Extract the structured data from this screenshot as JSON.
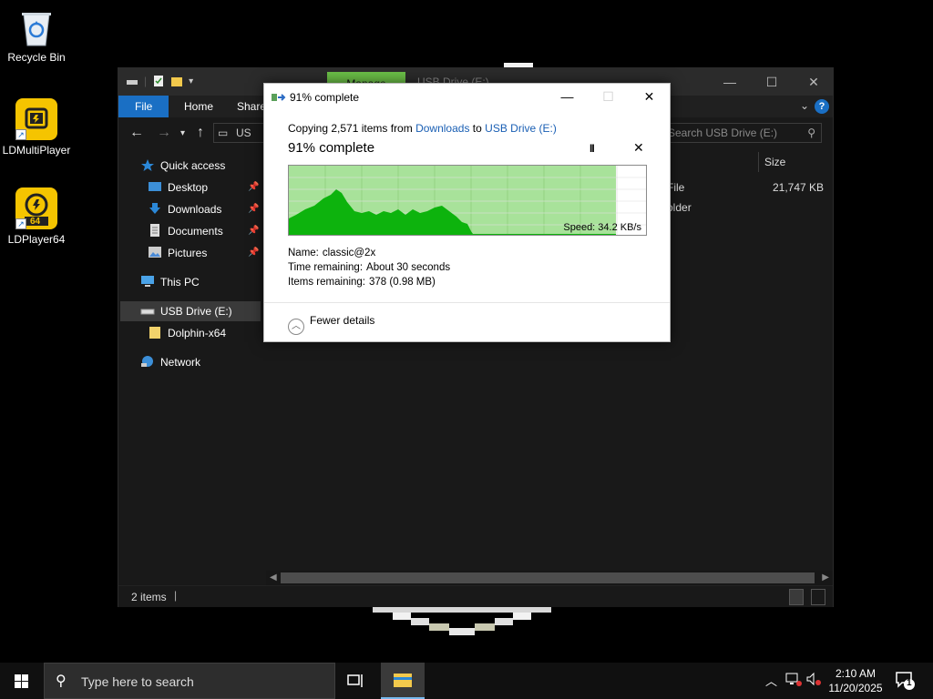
{
  "desktop": {
    "icons": [
      {
        "label": "Recycle Bin",
        "icon": "recycle-bin-icon"
      },
      {
        "label": "LDMultiPlayer",
        "icon": "ldmultiplayer-icon"
      },
      {
        "label": "LDPlayer64",
        "icon": "ldplayer64-icon",
        "badge": "64"
      }
    ]
  },
  "explorer": {
    "title": "USB Drive (E:)",
    "manage_tab": "Manage",
    "ribbon_tabs": [
      "File",
      "Home",
      "Share"
    ],
    "address_text": "US",
    "search_placeholder": "Search USB Drive (E:)",
    "nav": {
      "quick_access": "Quick access",
      "desktop": "Desktop",
      "downloads": "Downloads",
      "documents": "Documents",
      "pictures": "Pictures",
      "this_pc": "This PC",
      "usb_drive": "USB Drive (E:)",
      "dolphin": "Dolphin-x64",
      "network": "Network"
    },
    "columns": {
      "size": "Size"
    },
    "rows": [
      {
        "type_partial": "File",
        "size": "21,747 KB"
      },
      {
        "type_partial": "older",
        "size": ""
      }
    ],
    "status": "2 items"
  },
  "dialog": {
    "title": "91% complete",
    "copying_prefix": "Copying 2,571 items from",
    "source": "Downloads",
    "to": "to",
    "destination": "USB Drive (E:)",
    "heading": "91% complete",
    "pause_label": "II",
    "stop_label": "✕",
    "speed": "Speed: 34.2 KB/s",
    "progress_fraction": 0.91,
    "name_label": "Name:",
    "name_value": "classic@2x",
    "time_label": "Time remaining:",
    "time_value": "About 30 seconds",
    "items_label": "Items remaining:",
    "items_value": "378 (0.98 MB)",
    "fewer_details": "Fewer details",
    "colors": {
      "progress_fill": "#a8e29a",
      "speed_fill": "#0db30d",
      "accent": "#1a5fb4"
    }
  },
  "taskbar": {
    "search_placeholder": "Type here to search",
    "time": "2:10 AM",
    "date": "11/20/2025",
    "notification_count": "1"
  }
}
